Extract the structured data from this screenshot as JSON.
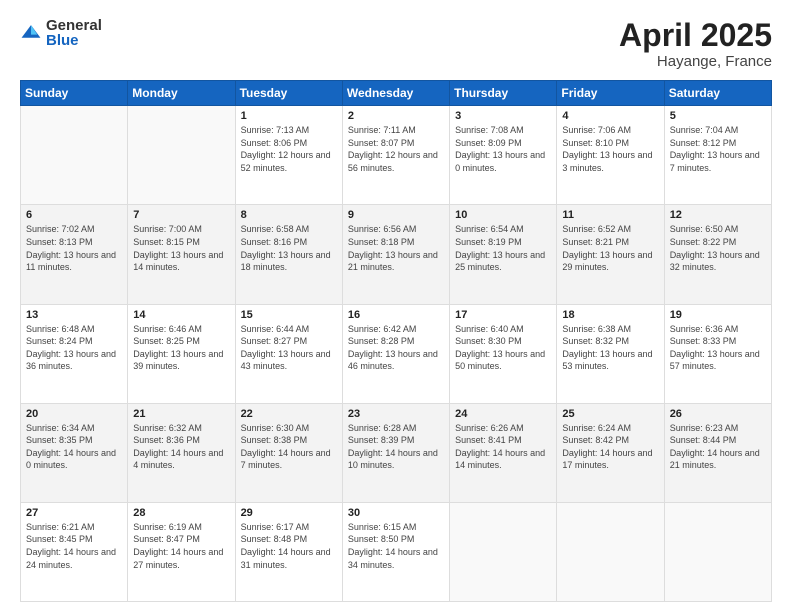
{
  "logo": {
    "general": "General",
    "blue": "Blue"
  },
  "title": {
    "month_year": "April 2025",
    "location": "Hayange, France"
  },
  "weekdays": [
    "Sunday",
    "Monday",
    "Tuesday",
    "Wednesday",
    "Thursday",
    "Friday",
    "Saturday"
  ],
  "weeks": [
    [
      {
        "day": "",
        "info": ""
      },
      {
        "day": "",
        "info": ""
      },
      {
        "day": "1",
        "info": "Sunrise: 7:13 AM\nSunset: 8:06 PM\nDaylight: 12 hours and 52 minutes."
      },
      {
        "day": "2",
        "info": "Sunrise: 7:11 AM\nSunset: 8:07 PM\nDaylight: 12 hours and 56 minutes."
      },
      {
        "day": "3",
        "info": "Sunrise: 7:08 AM\nSunset: 8:09 PM\nDaylight: 13 hours and 0 minutes."
      },
      {
        "day": "4",
        "info": "Sunrise: 7:06 AM\nSunset: 8:10 PM\nDaylight: 13 hours and 3 minutes."
      },
      {
        "day": "5",
        "info": "Sunrise: 7:04 AM\nSunset: 8:12 PM\nDaylight: 13 hours and 7 minutes."
      }
    ],
    [
      {
        "day": "6",
        "info": "Sunrise: 7:02 AM\nSunset: 8:13 PM\nDaylight: 13 hours and 11 minutes."
      },
      {
        "day": "7",
        "info": "Sunrise: 7:00 AM\nSunset: 8:15 PM\nDaylight: 13 hours and 14 minutes."
      },
      {
        "day": "8",
        "info": "Sunrise: 6:58 AM\nSunset: 8:16 PM\nDaylight: 13 hours and 18 minutes."
      },
      {
        "day": "9",
        "info": "Sunrise: 6:56 AM\nSunset: 8:18 PM\nDaylight: 13 hours and 21 minutes."
      },
      {
        "day": "10",
        "info": "Sunrise: 6:54 AM\nSunset: 8:19 PM\nDaylight: 13 hours and 25 minutes."
      },
      {
        "day": "11",
        "info": "Sunrise: 6:52 AM\nSunset: 8:21 PM\nDaylight: 13 hours and 29 minutes."
      },
      {
        "day": "12",
        "info": "Sunrise: 6:50 AM\nSunset: 8:22 PM\nDaylight: 13 hours and 32 minutes."
      }
    ],
    [
      {
        "day": "13",
        "info": "Sunrise: 6:48 AM\nSunset: 8:24 PM\nDaylight: 13 hours and 36 minutes."
      },
      {
        "day": "14",
        "info": "Sunrise: 6:46 AM\nSunset: 8:25 PM\nDaylight: 13 hours and 39 minutes."
      },
      {
        "day": "15",
        "info": "Sunrise: 6:44 AM\nSunset: 8:27 PM\nDaylight: 13 hours and 43 minutes."
      },
      {
        "day": "16",
        "info": "Sunrise: 6:42 AM\nSunset: 8:28 PM\nDaylight: 13 hours and 46 minutes."
      },
      {
        "day": "17",
        "info": "Sunrise: 6:40 AM\nSunset: 8:30 PM\nDaylight: 13 hours and 50 minutes."
      },
      {
        "day": "18",
        "info": "Sunrise: 6:38 AM\nSunset: 8:32 PM\nDaylight: 13 hours and 53 minutes."
      },
      {
        "day": "19",
        "info": "Sunrise: 6:36 AM\nSunset: 8:33 PM\nDaylight: 13 hours and 57 minutes."
      }
    ],
    [
      {
        "day": "20",
        "info": "Sunrise: 6:34 AM\nSunset: 8:35 PM\nDaylight: 14 hours and 0 minutes."
      },
      {
        "day": "21",
        "info": "Sunrise: 6:32 AM\nSunset: 8:36 PM\nDaylight: 14 hours and 4 minutes."
      },
      {
        "day": "22",
        "info": "Sunrise: 6:30 AM\nSunset: 8:38 PM\nDaylight: 14 hours and 7 minutes."
      },
      {
        "day": "23",
        "info": "Sunrise: 6:28 AM\nSunset: 8:39 PM\nDaylight: 14 hours and 10 minutes."
      },
      {
        "day": "24",
        "info": "Sunrise: 6:26 AM\nSunset: 8:41 PM\nDaylight: 14 hours and 14 minutes."
      },
      {
        "day": "25",
        "info": "Sunrise: 6:24 AM\nSunset: 8:42 PM\nDaylight: 14 hours and 17 minutes."
      },
      {
        "day": "26",
        "info": "Sunrise: 6:23 AM\nSunset: 8:44 PM\nDaylight: 14 hours and 21 minutes."
      }
    ],
    [
      {
        "day": "27",
        "info": "Sunrise: 6:21 AM\nSunset: 8:45 PM\nDaylight: 14 hours and 24 minutes."
      },
      {
        "day": "28",
        "info": "Sunrise: 6:19 AM\nSunset: 8:47 PM\nDaylight: 14 hours and 27 minutes."
      },
      {
        "day": "29",
        "info": "Sunrise: 6:17 AM\nSunset: 8:48 PM\nDaylight: 14 hours and 31 minutes."
      },
      {
        "day": "30",
        "info": "Sunrise: 6:15 AM\nSunset: 8:50 PM\nDaylight: 14 hours and 34 minutes."
      },
      {
        "day": "",
        "info": ""
      },
      {
        "day": "",
        "info": ""
      },
      {
        "day": "",
        "info": ""
      }
    ]
  ]
}
